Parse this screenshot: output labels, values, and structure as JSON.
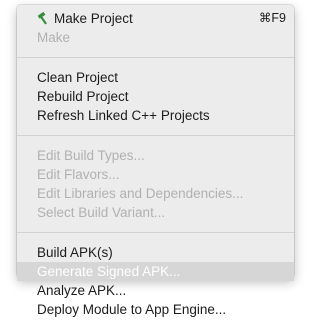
{
  "menu": {
    "group1": {
      "make_project": {
        "label": "Make Project",
        "shortcut": "⌘F9",
        "icon": "hammer-icon",
        "icon_color": "#3a8d3a"
      },
      "make": {
        "label": "Make"
      }
    },
    "group2": {
      "clean_project": {
        "label": "Clean Project"
      },
      "rebuild_project": {
        "label": "Rebuild Project"
      },
      "refresh_cpp": {
        "label": "Refresh Linked C++ Projects"
      }
    },
    "group3": {
      "edit_build_types": {
        "label": "Edit Build Types..."
      },
      "edit_flavors": {
        "label": "Edit Flavors..."
      },
      "edit_libraries": {
        "label": "Edit Libraries and Dependencies..."
      },
      "select_variant": {
        "label": "Select Build Variant..."
      }
    },
    "group4": {
      "build_apk": {
        "label": "Build APK(s)"
      },
      "generate_signed_apk": {
        "label": "Generate Signed APK..."
      },
      "analyze_apk": {
        "label": "Analyze APK..."
      },
      "deploy_module": {
        "label": "Deploy Module to App Engine..."
      }
    }
  }
}
